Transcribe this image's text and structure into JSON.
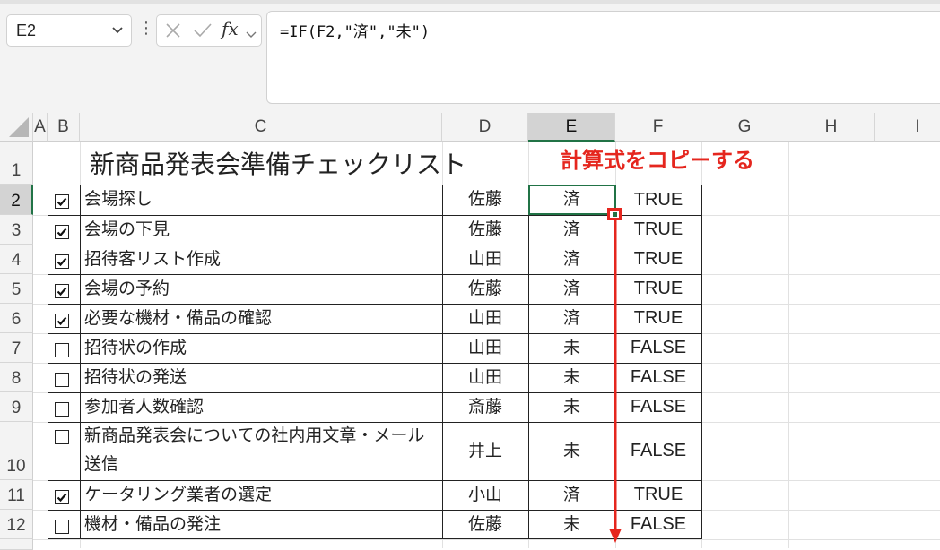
{
  "name_box": {
    "value": "E2"
  },
  "formula_bar": {
    "formula": "=IF(F2,\"済\",\"未\")",
    "fx_label": "fx"
  },
  "columns": [
    "A",
    "B",
    "C",
    "D",
    "E",
    "F",
    "G",
    "H",
    "I"
  ],
  "rows": [
    "1",
    "2",
    "3",
    "4",
    "5",
    "6",
    "7",
    "8",
    "9",
    "10",
    "11",
    "12"
  ],
  "sheet": {
    "title": "新商品発表会準備チェックリスト",
    "annotation": "計算式をコピーする",
    "tasks": [
      {
        "checked": true,
        "task": "会場探し",
        "person": "佐藤",
        "status": "済",
        "flag": "TRUE"
      },
      {
        "checked": true,
        "task": "会場の下見",
        "person": "佐藤",
        "status": "済",
        "flag": "TRUE"
      },
      {
        "checked": true,
        "task": "招待客リスト作成",
        "person": "山田",
        "status": "済",
        "flag": "TRUE"
      },
      {
        "checked": true,
        "task": "会場の予約",
        "person": "佐藤",
        "status": "済",
        "flag": "TRUE"
      },
      {
        "checked": true,
        "task": "必要な機材・備品の確認",
        "person": "山田",
        "status": "済",
        "flag": "TRUE"
      },
      {
        "checked": false,
        "task": "招待状の作成",
        "person": "山田",
        "status": "未",
        "flag": "FALSE"
      },
      {
        "checked": false,
        "task": "招待状の発送",
        "person": "山田",
        "status": "未",
        "flag": "FALSE"
      },
      {
        "checked": false,
        "task": "参加者人数確認",
        "person": "斎藤",
        "status": "未",
        "flag": "FALSE"
      },
      {
        "checked": false,
        "task": "新商品発表会についての社内用文章・メール",
        "task_line2": "送信",
        "person": "井上",
        "status": "未",
        "flag": "FALSE"
      },
      {
        "checked": true,
        "task": "ケータリング業者の選定",
        "person": "小山",
        "status": "済",
        "flag": "TRUE"
      },
      {
        "checked": false,
        "task": "機材・備品の発注",
        "person": "佐藤",
        "status": "未",
        "flag": "FALSE"
      }
    ]
  },
  "colors": {
    "accent_green": "#217346",
    "annotation_red": "#e5261e"
  }
}
